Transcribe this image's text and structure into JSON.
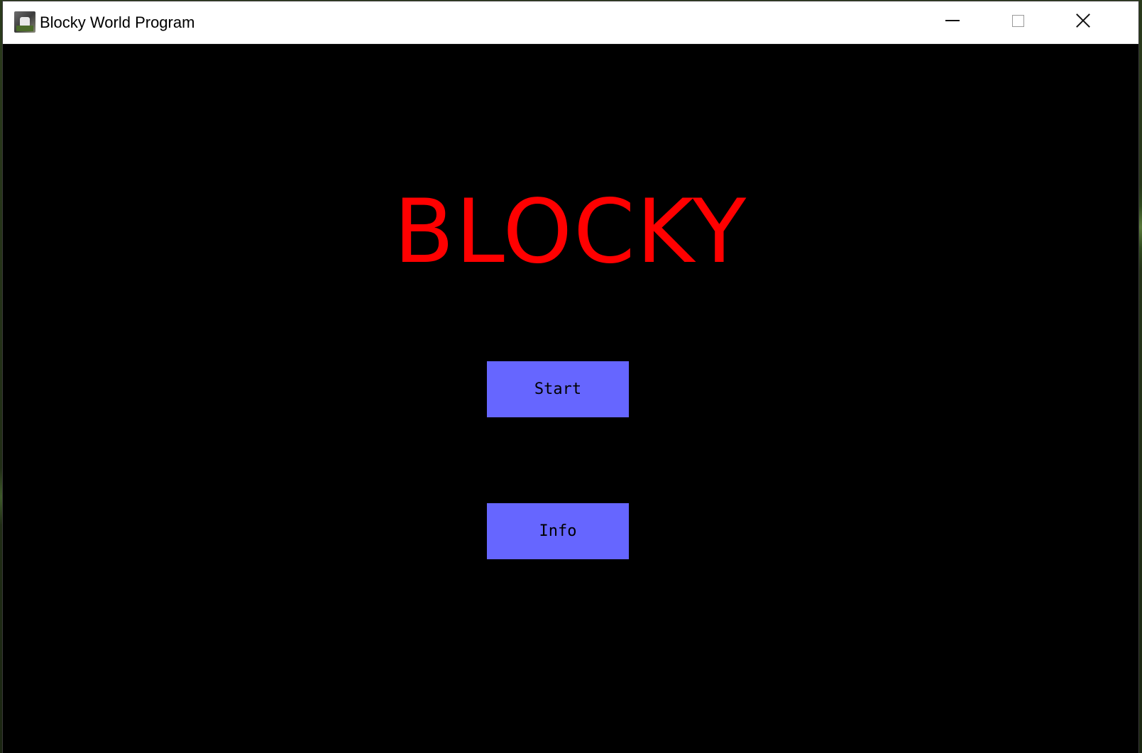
{
  "window": {
    "title": "Blocky World Program",
    "controls": {
      "minimize": "minimize-icon",
      "maximize": "maximize-icon",
      "close": "close-icon"
    }
  },
  "main": {
    "title": "BLOCKY",
    "title_color": "#ff0000",
    "background_color": "#000000",
    "buttons": [
      {
        "label": "Start",
        "color": "#6666ff"
      },
      {
        "label": "Info",
        "color": "#6666ff"
      }
    ]
  }
}
